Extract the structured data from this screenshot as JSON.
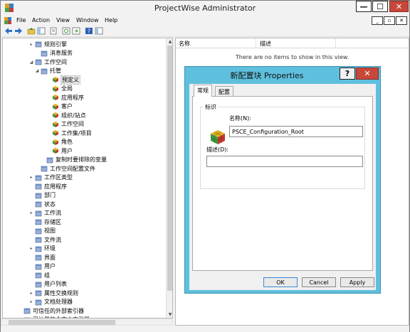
{
  "window": {
    "title": "ProjectWise Administrator",
    "min_glyph": "—",
    "max_glyph": "☐",
    "close_glyph": "✕"
  },
  "menu": {
    "items": [
      "File",
      "Action",
      "View",
      "Window",
      "Help"
    ],
    "mdi_min": "_",
    "mdi_restore": "▫",
    "mdi_close": "✕"
  },
  "tree": {
    "items": [
      {
        "label": "规则引擎",
        "icon": "rules-engine-icon",
        "exp": "▸"
      },
      {
        "label": "消息服务",
        "icon": "message-service-icon",
        "exp": ""
      },
      {
        "label": "工作空间",
        "icon": "workspace-icon",
        "exp": "◢"
      },
      {
        "label": "托管",
        "icon": "managed-icon",
        "exp": "◢"
      },
      {
        "label": "预定义",
        "icon": "config-block-icon",
        "exp": ""
      },
      {
        "label": "全局",
        "icon": "config-block-icon",
        "exp": ""
      },
      {
        "label": "应用程序",
        "icon": "config-block-icon",
        "exp": ""
      },
      {
        "label": "客户",
        "icon": "config-block-icon",
        "exp": ""
      },
      {
        "label": "组织/站点",
        "icon": "config-block-icon",
        "exp": ""
      },
      {
        "label": "工作空间",
        "icon": "config-block-icon",
        "exp": ""
      },
      {
        "label": "工作集/项目",
        "icon": "config-block-icon",
        "exp": ""
      },
      {
        "label": "角色",
        "icon": "config-block-icon",
        "exp": ""
      },
      {
        "label": "用户",
        "icon": "config-block-icon",
        "exp": ""
      },
      {
        "label": "复制时要排除的变量",
        "icon": "exclude-variables-icon",
        "exp": ""
      },
      {
        "label": "工作空间配置文件",
        "icon": "workspace-config-file-icon",
        "exp": ""
      },
      {
        "label": "工作区类型",
        "icon": "workarea-type-icon",
        "exp": "▸"
      },
      {
        "label": "应用程序",
        "icon": "application-icon",
        "exp": ""
      },
      {
        "label": "部门",
        "icon": "department-icon",
        "exp": ""
      },
      {
        "label": "状态",
        "icon": "state-icon",
        "exp": ""
      },
      {
        "label": "工作流",
        "icon": "workflow-icon",
        "exp": "▸"
      },
      {
        "label": "存储区",
        "icon": "storage-icon",
        "exp": ""
      },
      {
        "label": "视图",
        "icon": "view-icon",
        "exp": ""
      },
      {
        "label": "文件流",
        "icon": "file-flow-icon",
        "exp": ""
      },
      {
        "label": "环境",
        "icon": "environment-icon",
        "exp": "▸"
      },
      {
        "label": "界面",
        "icon": "interface-icon",
        "exp": ""
      },
      {
        "label": "用户",
        "icon": "user-icon",
        "exp": ""
      },
      {
        "label": "组",
        "icon": "group-icon",
        "exp": ""
      },
      {
        "label": "用户列表",
        "icon": "user-list-icon",
        "exp": ""
      },
      {
        "label": "属性交换规则",
        "icon": "attribute-exchange-icon",
        "exp": "▸"
      },
      {
        "label": "文档处理器",
        "icon": "document-processor-icon",
        "exp": "▸"
      },
      {
        "label": "可信任的外部索引器",
        "icon": "trusted-indexer-icon",
        "exp": ""
      },
      {
        "label": "已注册的全文本索引器",
        "icon": "fulltext-indexer-icon",
        "exp": ""
      }
    ]
  },
  "list": {
    "columns": [
      "名称",
      "描述"
    ],
    "empty_message": "There are no items to show in this view."
  },
  "dialog": {
    "title": "新配置块 Properties",
    "help_glyph": "?",
    "close_glyph": "✕",
    "tabs": [
      "常规",
      "配置"
    ],
    "group_title": "标识",
    "name_label": "名称(N):",
    "name_value": "PSCE_Configuration_Root",
    "desc_label": "描述(D):",
    "desc_value": "",
    "buttons": {
      "ok": "OK",
      "cancel": "Cancel",
      "apply": "Apply"
    }
  },
  "colors": {
    "dialog_frame": "#5fc0de",
    "close_red": "#c7483b",
    "selection": "#e6e6e6"
  }
}
